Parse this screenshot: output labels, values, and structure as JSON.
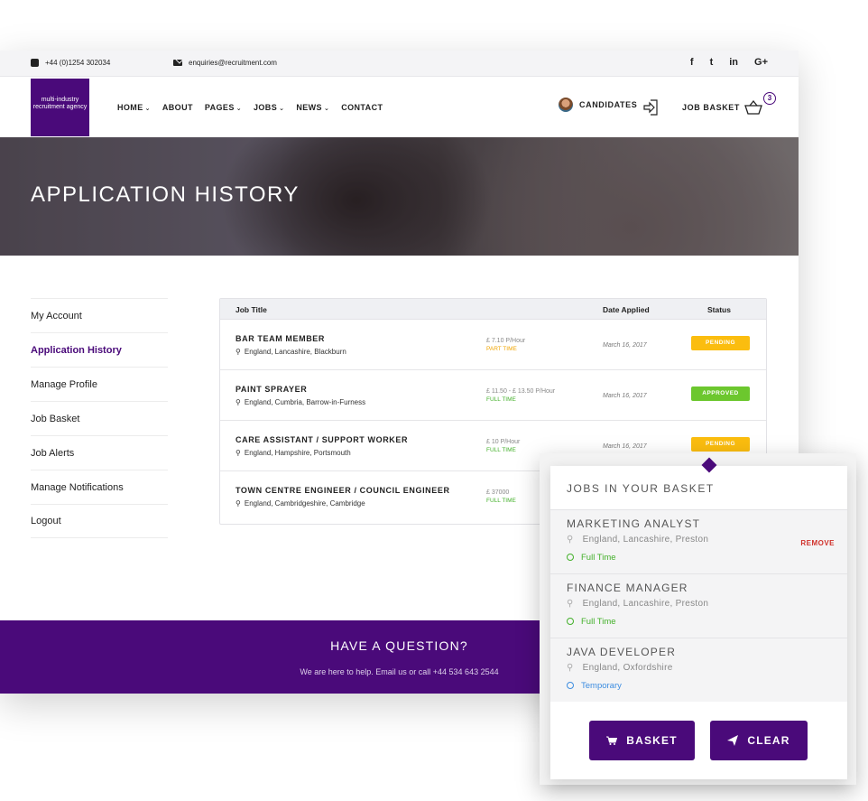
{
  "topbar": {
    "phone": "+44 (0)1254 302034",
    "email": "enquiries@recruitment.com",
    "socials": [
      "f",
      "t",
      "in",
      "G+"
    ]
  },
  "navbar": {
    "logo_text": "multi-industry recruitment agency",
    "menu": [
      "HOME",
      "ABOUT",
      "PAGES",
      "JOBS",
      "NEWS",
      "CONTACT"
    ],
    "candidates_label": "CANDIDATES",
    "basket_label": "JOB BASKET",
    "basket_count": "3"
  },
  "hero": {
    "title": "APPLICATION HISTORY"
  },
  "sidebar": {
    "items": [
      "My Account",
      "Application History",
      "Manage Profile",
      "Job Basket",
      "Job Alerts",
      "Manage Notifications",
      "Logout"
    ],
    "active": "Application History"
  },
  "table": {
    "headers": {
      "title": "Job Title",
      "date": "Date Applied",
      "status": "Status"
    },
    "rows": [
      {
        "title": "BAR TEAM MEMBER",
        "location": "England, Lancashire, Blackburn",
        "pay": "£ 7.10 P/Hour",
        "type": "PART TIME",
        "type_color": "#f0a500",
        "date": "March 16, 2017",
        "status": "PENDING",
        "status_color": "#fbbd0f"
      },
      {
        "title": "PAINT SPRAYER",
        "location": "England, Cumbria, Barrow-in-Furness",
        "pay": "£ 11.50 - £ 13.50 P/Hour",
        "type": "FULL TIME",
        "type_color": "#43b02a",
        "date": "March 16, 2017",
        "status": "APPROVED",
        "status_color": "#6cc72e"
      },
      {
        "title": "CARE ASSISTANT / SUPPORT WORKER",
        "location": "England, Hampshire, Portsmouth",
        "pay": "£ 10 P/Hour",
        "type": "FULL TIME",
        "type_color": "#43b02a",
        "date": "March 16, 2017",
        "status": "PENDING",
        "status_color": "#fbbd0f"
      },
      {
        "title": "TOWN CENTRE ENGINEER / COUNCIL ENGINEER",
        "location": "England, Cambridgeshire, Cambridge",
        "pay": "£ 37000",
        "type": "FULL TIME",
        "type_color": "#43b02a",
        "date": "",
        "status": "",
        "status_color": ""
      }
    ]
  },
  "footer": {
    "heading": "HAVE A QUESTION?",
    "text": "We are here to help. Email us or call +44 534 643 2544"
  },
  "basket_popup": {
    "title": "JOBS IN YOUR BASKET",
    "items": [
      {
        "title": "MARKETING ANALYST",
        "location": "England, Lancashire, Preston",
        "type": "Full Time",
        "type_color": "#43b02a",
        "remove": "REMOVE"
      },
      {
        "title": "FINANCE MANAGER",
        "location": "England, Lancashire, Preston",
        "type": "Full Time",
        "type_color": "#43b02a"
      },
      {
        "title": "JAVA DEVELOPER",
        "location": "England, Oxfordshire",
        "type": "Temporary",
        "type_color": "#3d8de0"
      }
    ],
    "basket_button": "BASKET",
    "clear_button": "CLEAR"
  },
  "colors": {
    "brand": "#4a0a7a",
    "pending": "#fbbd0f",
    "approved": "#6cc72e",
    "remove": "#d0302a"
  }
}
